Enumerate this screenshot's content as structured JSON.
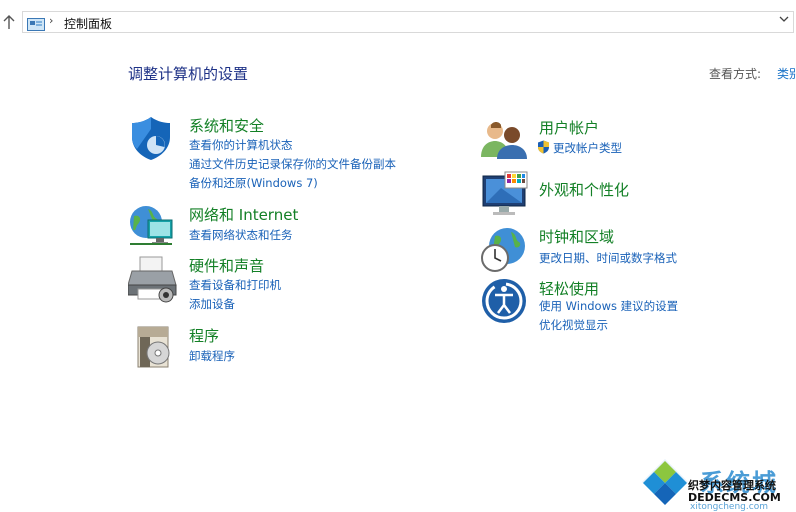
{
  "address_bar": {
    "breadcrumb": "控制面板",
    "separator": "›",
    "dropdown_glyph": "⌄"
  },
  "header": {
    "title": "调整计算机的设置",
    "view_by_label": "查看方式:",
    "view_by_value": "类别"
  },
  "categories": {
    "security": {
      "icon": "shield-icon",
      "title": "系统和安全",
      "links": [
        "查看你的计算机状态",
        "通过文件历史记录保存你的文件备份副本",
        "备份和还原(Windows 7)"
      ]
    },
    "network": {
      "icon": "network-globe-icon",
      "title": "网络和 Internet",
      "links": [
        "查看网络状态和任务"
      ]
    },
    "hardware": {
      "icon": "printer-icon",
      "title": "硬件和声音",
      "links": [
        "查看设备和打印机",
        "添加设备"
      ]
    },
    "programs": {
      "icon": "programs-disc-icon",
      "title": "程序",
      "links": [
        "卸载程序"
      ]
    },
    "user_accounts": {
      "icon": "users-icon",
      "title": "用户帐户",
      "links": [
        "更改帐户类型"
      ],
      "link_icon": "uac-shield-icon"
    },
    "appearance": {
      "icon": "monitor-personalize-icon",
      "title": "外观和个性化",
      "links": []
    },
    "clock_region": {
      "icon": "clock-globe-icon",
      "title": "时钟和区域",
      "links": [
        "更改日期、时间或数字格式"
      ]
    },
    "ease_of_access": {
      "icon": "ease-of-access-icon",
      "title": "轻松使用",
      "links": [
        "使用 Windows 建议的设置",
        "优化视觉显示"
      ]
    }
  },
  "watermark": {
    "brand": "系统城",
    "line1": "织梦内容管理系统",
    "line2": "DEDECMS.COM",
    "line3": "xitongcheng.com"
  },
  "colors": {
    "category_title": "#138026",
    "link": "#1a62b8",
    "page_title": "#1e3287"
  }
}
